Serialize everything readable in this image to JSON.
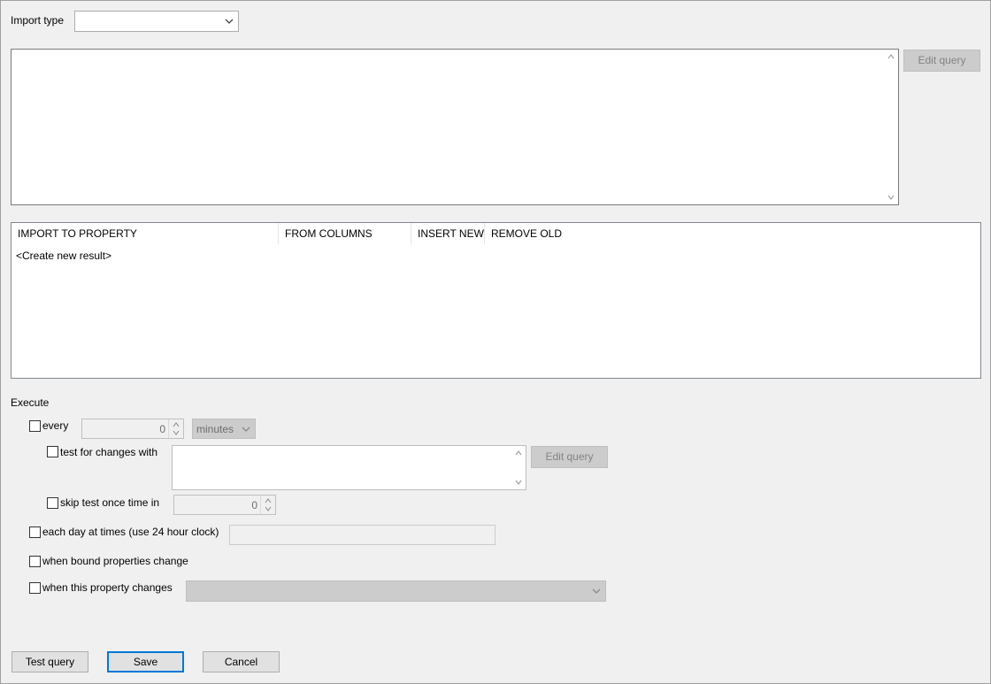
{
  "import_type": {
    "label": "Import type",
    "value": ""
  },
  "query_box": {
    "edit_button": "Edit query"
  },
  "results_table": {
    "columns": [
      "IMPORT TO PROPERTY",
      "FROM COLUMNS",
      "INSERT NEW",
      "REMOVE OLD"
    ],
    "rows": [
      "<Create new result>"
    ]
  },
  "execute": {
    "heading": "Execute",
    "every": {
      "label": "every",
      "value": "0",
      "unit": "minutes"
    },
    "test_changes": {
      "label": "test for changes with",
      "edit_button": "Edit query"
    },
    "skip_test": {
      "label": "skip test once time in",
      "value": "0"
    },
    "each_day": {
      "label": "each day at times (use 24 hour clock)",
      "value": ""
    },
    "bound_props": {
      "label": "when bound properties change"
    },
    "this_prop": {
      "label": "when this property changes",
      "value": ""
    }
  },
  "footer": {
    "test_query": "Test query",
    "save": "Save",
    "cancel": "Cancel"
  },
  "colors": {
    "accent": "#0078d7",
    "window_bg": "#f0f0f0",
    "disabled_bg": "#cccccc"
  }
}
